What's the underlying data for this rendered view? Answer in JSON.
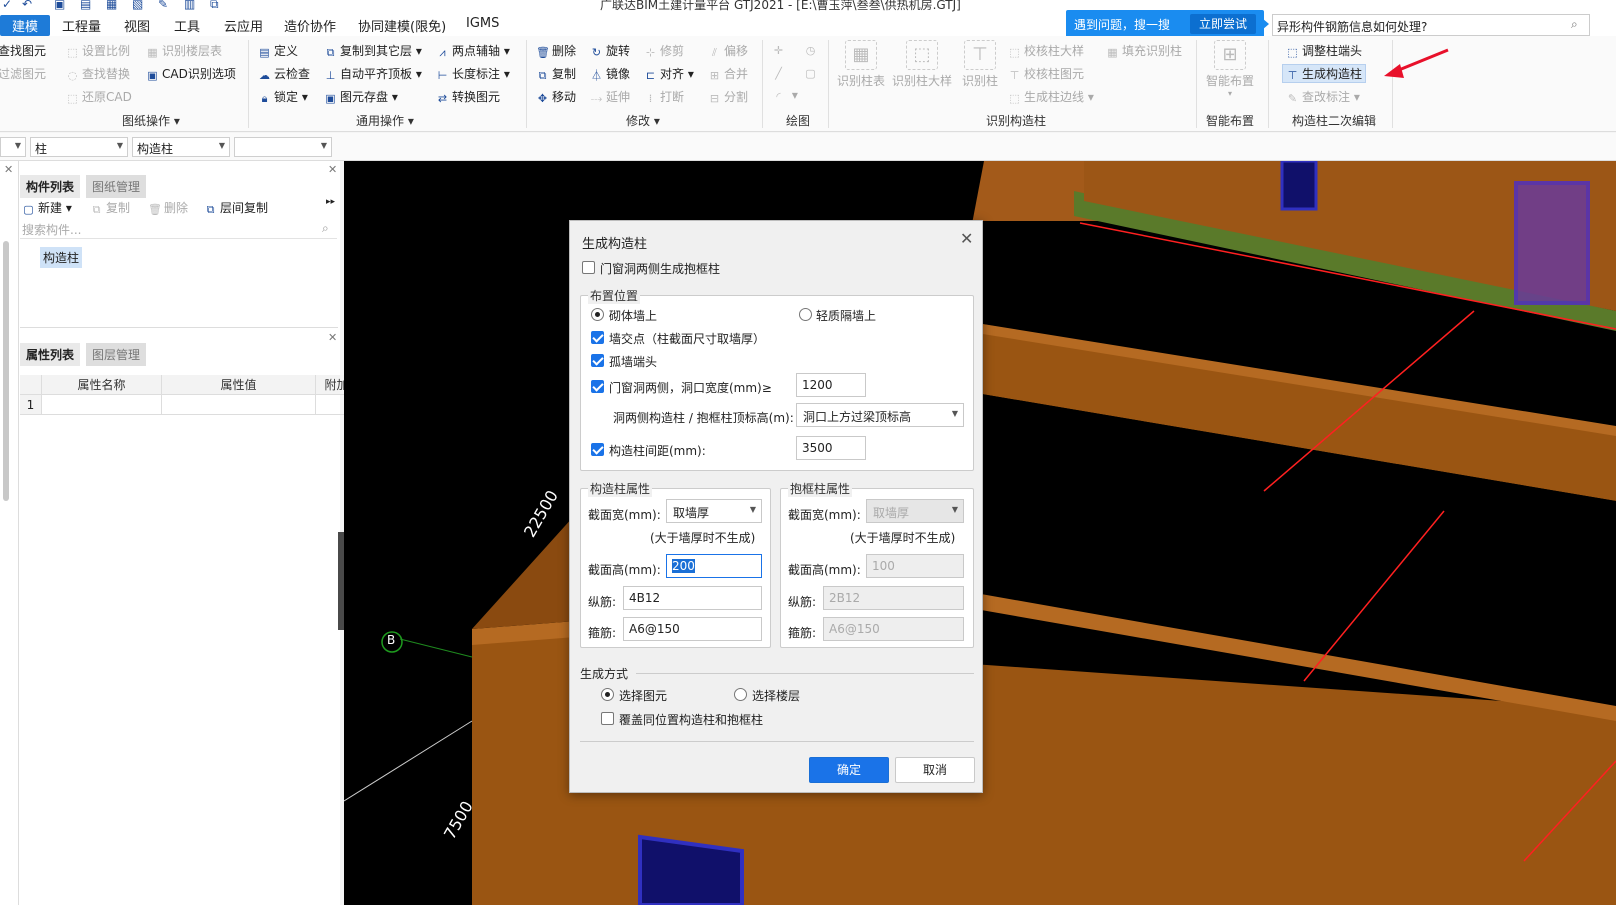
{
  "window": {
    "title": "广联达BIM土建计量平台 GTJ2021 - [E:\\曹玉萍\\叁叁\\供热机房.GTJ]"
  },
  "menu": [
    "建模",
    "工程量",
    "视图",
    "工具",
    "云应用",
    "造价协作",
    "协同建模(限免)",
    "IGMS"
  ],
  "help": {
    "prompt": "遇到问题，搜一搜",
    "try_button": "立即尝试",
    "search_value": "异形构件钢筋信息如何处理?"
  },
  "ribbon": {
    "drawing_ops": {
      "label": "图纸操作",
      "items": [
        "查找图元",
        "过滤图元",
        "设置比例",
        "查找替换",
        "还原CAD",
        "识别楼层表",
        "CAD识别选项"
      ]
    },
    "general_ops": {
      "label": "通用操作",
      "items": [
        "定义",
        "云检查",
        "锁定",
        "复制到其它层",
        "自动平齐顶板",
        "图元存盘",
        "两点辅轴",
        "长度标注",
        "转换图元"
      ]
    },
    "modify": {
      "label": "修改",
      "items": [
        "删除",
        "复制",
        "移动",
        "旋转",
        "镜像",
        "延伸",
        "修剪",
        "对齐",
        "打断",
        "偏移",
        "合并",
        "分割"
      ]
    },
    "draw": {
      "label": "绘图"
    },
    "identify": {
      "label": "识别构造柱",
      "items": [
        "识别柱表",
        "识别柱大样",
        "识别柱",
        "校核柱大样",
        "校核柱图元",
        "生成柱边线",
        "填充识别柱"
      ]
    },
    "smart": {
      "label": "智能布置",
      "items": [
        "智能布置"
      ]
    },
    "edit2": {
      "label": "构造柱二次编辑",
      "items": [
        "调整柱端头",
        "生成构造柱",
        "查改标注"
      ]
    }
  },
  "filter": {
    "values": [
      "柱",
      "构造柱"
    ]
  },
  "left_panel": {
    "tabs_top": [
      "构件列表",
      "图纸管理"
    ],
    "tools": [
      "新建",
      "复制",
      "删除",
      "层间复制"
    ],
    "search_placeholder": "搜索构件...",
    "component": "构造柱",
    "tabs_bottom": [
      "属性列表",
      "图层管理"
    ],
    "prop_headers": [
      "属性名称",
      "属性值",
      "附加"
    ],
    "prop_row_index": "1"
  },
  "viewport": {
    "axis_label": "B",
    "dim1": "22500",
    "dim2": "7500"
  },
  "dialog": {
    "title": "生成构造柱",
    "door_window_check": "门窗洞两侧生成抱框柱",
    "placement": {
      "legend": "布置位置",
      "radio_masonry": "砌体墙上",
      "radio_light": "轻质隔墙上",
      "wall_intersection": "墙交点（柱截面尺寸取墙厚）",
      "isolated_end": "孤墙端头",
      "opening_sides": "门窗洞两侧，洞口宽度(mm)≥",
      "opening_width": "1200",
      "top_elev_label": "洞两侧构造柱 / 抱框柱顶标高(m):",
      "top_elev_value": "洞口上方过梁顶标高",
      "spacing_label": "构造柱间距(mm):",
      "spacing_value": "3500"
    },
    "col_props": {
      "legend": "构造柱属性",
      "width_label": "截面宽(mm):",
      "width_value": "取墙厚",
      "note": "(大于墙厚时不生成)",
      "height_label": "截面高(mm):",
      "height_value": "200",
      "rebar_label": "纵筋:",
      "rebar_value": "4B12",
      "stirrup_label": "箍筋:",
      "stirrup_value": "A6@150"
    },
    "frame_props": {
      "legend": "抱框柱属性",
      "width_label": "截面宽(mm):",
      "width_value": "取墙厚",
      "note": "(大于墙厚时不生成)",
      "height_label": "截面高(mm):",
      "height_value": "100",
      "rebar_label": "纵筋:",
      "rebar_value": "2B12",
      "stirrup_label": "箍筋:",
      "stirrup_value": "A6@150"
    },
    "generate": {
      "legend": "生成方式",
      "radio_element": "选择图元",
      "radio_floor": "选择楼层",
      "override": "覆盖同位置构造柱和抱框柱"
    },
    "ok": "确定",
    "cancel": "取消"
  },
  "colors": {
    "accent": "#1a73e8",
    "wall": "#a35a1a",
    "viewport_bg": "#000000",
    "red_line": "#ff2020"
  }
}
